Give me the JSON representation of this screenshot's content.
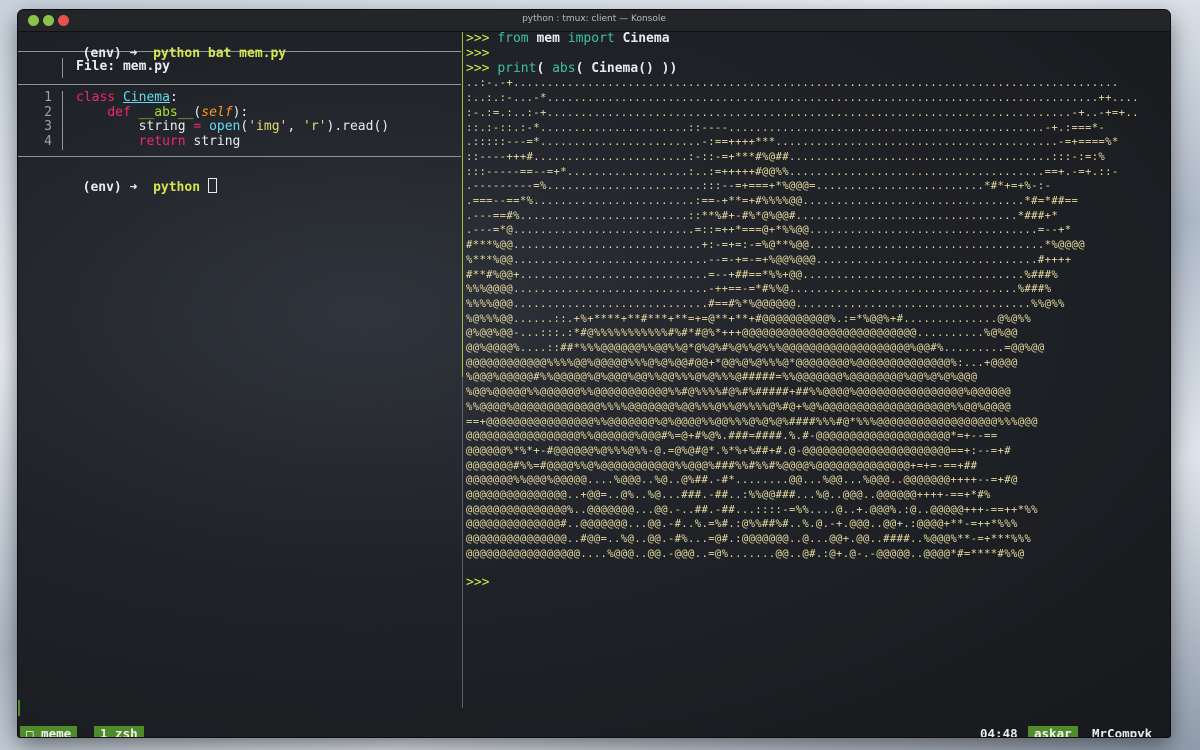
{
  "window": {
    "title": "python : tmux: client — Konsole",
    "controls": [
      "minimize",
      "maximize",
      "close"
    ]
  },
  "left_pane": {
    "prompt_env": "(env)",
    "arrow": "➜",
    "command": "python bat mem.py",
    "file_label": "File: mem.py",
    "line_numbers": [
      "1",
      "2",
      "3",
      "4"
    ],
    "code": [
      {
        "kw": "class",
        "name": "Cinema",
        "rest": ":"
      },
      {
        "indent": "    ",
        "kw": "def",
        "fn": "__abs__",
        "paren_open": "(",
        "param": "self",
        "rest": "):"
      },
      {
        "indent": "        ",
        "var": "string",
        "eq": " = ",
        "fn": "open",
        "args_open": "(",
        "s1": "'img'",
        "sep": ", ",
        "s2": "'r'",
        "tail": ").read()"
      },
      {
        "indent": "        ",
        "kw": "return",
        "rest": " string"
      }
    ],
    "prompt2_env": "(env)",
    "arrow2": "➜",
    "command2": "python"
  },
  "right_pane": {
    "py_prompt": ">>>",
    "line1": {
      "kw1": "from",
      "mod": " mem ",
      "kw2": "import",
      "name": " Cinema"
    },
    "line3": {
      "fn": "print",
      "p1": "( ",
      "fn2": "abs",
      "rest": "( Cinema() ))"
    },
    "ascii_art": [
      "..:-.-+..........................................................................................",
      ":..:.:-...-*..................................................................................++....",
      ":-.:=.:..:-+..............................................................................-+..-+=+..",
      "::.:-::.:-*......................::----...............................................-+.:===*-",
      ".:::::---=*........................-:==++++***..........................................-=+====%*",
      "::----+++#.......................:-::-=+***#%@##.......................................:::-:=:%",
      ":::-----==--=+*..................:..:=+++++#@@%%......................................==+.-=+.::-",
      ".---------=%.......................:::--=+===+*%@@@=.........................*#*+=+%-:-",
      ".===--==*%........................:==-+**=+#%%%%@@.................................*#=*##==",
      ".---==#%.........................::**%#+-#%*@%@@#.................................*###+*",
      ".---=*@...........................=::=++*===@+*%%@@..................................=--+*",
      "#***%@@............................+:-=+=:-=%@**%@@...................................*%@@@@",
      "%***%@@.............................--=-+=-=+%@@%@@@.................................#++++",
      "#**#%@@+............................=--+##==*%%+@@.................................%###%",
      "%%%@@@@.............................-++==-=*#%%@..................................%###%",
      "%%%%@@@.............................#==#%*%@@@@@@...................................%%@%%",
      "%@%%%@@......::.+%+****+**#***+**=+=@**+**+#@@@@@@@@@@%.:=*%@@%+#..............@%@%%",
      "@%@@%@@-...:::.:*#@%%%%%%%%%%%#%#*#@%*+++@@@@@@@@@@@@@@@@@@@@@@@@@@..........%@%@@",
      "@@%@@@@%....::##*%%%@@@@@@%%@@%%@*@%@%#%@%%@%%%@@@@@@@@@@@@@@@@@@@%@@#%.........=@@%@@",
      "@@@@@@@@@@@@%%%%@@%@@@@@%%%@%@%@@#@@+*@@%@%@%%%@*@@@@@@@@%@@@@@@@@@@@@@@%:...+@@@@",
      "%@@@%@@@@@#%%@@@@@%@%@@@%@@%%@@%%%@%@%%%@#####=%%@@@@@@@%@@@@@@@@%@@%@%@%@@@",
      "%@@%@@@@@%%@@@@@@%%@@@@@@@@@@@%%#@%%%%#@%#%#####+##%%@@@@%@@@@@@@@@@@@@@@@%@@@@@@",
      "%%@@@@%@@@@@@@@@@@@@%%%%@@@@@@@%@@%%%@%%@%%%%@%#@+%@%@@@@@@@@@@@@@@@@@@@%%@@%@@@@",
      "==+@@@@@@@@@@@@@@@@%%@@@@@@@%@%@@@@%%@@%%%@%@%@%####%%%#@*%%%@@@@@@@@@@@@@@@@@@%%%@@@",
      "@@@@@@@@@@@@@@@@@%%@@@@@@%@@@#%=@+#%@%.###=####.%.#-@@@@@@@@@@@@@@@@@@@@*=+--==",
      "@@@@@@%*%*+-#@@@@@@%@%%%@%%-@.=@%@#@*.%*%+%##+#.@-@@@@@@@@@@@@@@@@@@@@@@==+:--=+#",
      "@@@@@@@#%%=#@@@@%%@%@@@@@@@@@@@%%@@@%###%%#%%#%@@@@%@@@@@@@@@@@@@@+=+=-==+##",
      "@@@@@@@%%@@@%@@@@@....%@@@..%@..@%##.-#*........@@...%@@...%@@@..@@@@@@@++++--=+#@",
      "@@@@@@@@@@@@@@@..+@@=..@%..%@...###.-##..:%%@@###...%@..@@@..@@@@@@++++-==+*#%",
      "@@@@@@@@@@@@@@@%..@@@@@@@...@@.-..##.-##...::::-=%%....@..+.@@@%.:@..@@@@@+++-==++*%%",
      "@@@@@@@@@@@@@@#..@@@@@@@...@@.-#..%.=%#.:@%%##%#..%.@.-+.@@@..@@+.:@@@@+**-=++*%%%",
      "@@@@@@@@@@@@@@@..#@@=..%@..@@.-#%...=@#.:@@@@@@@..@...@@+.@@..####..%@@@%**-=+***%%%",
      "@@@@@@@@@@@@@@@@@....%@@@..@@.-@@@..=@%.......@@..@#.:@+.@-.-@@@@@..@@@@*#=****#%%@"
    ],
    "final_prompt": ">>>"
  },
  "statusbar": {
    "session": "□ meme",
    "window": "1 zsh",
    "time": "04:48",
    "user": "askar",
    "host": "MrCompyk"
  },
  "colors": {
    "accent_green": "#4f8a2b",
    "python_prompt": "#d7e64f",
    "ascii_art": "#e9dca2",
    "close_btn": "#e5534b",
    "min_btn": "#8cc34a",
    "max_btn": "#8cc34a"
  }
}
